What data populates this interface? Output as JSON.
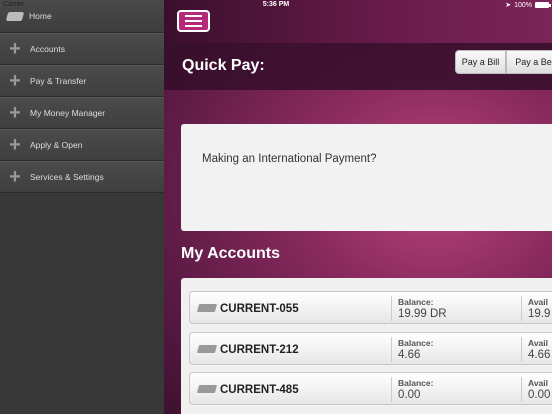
{
  "status_bar": {
    "carrier": "Carrier",
    "time": "5:36 PM",
    "battery": "100%"
  },
  "sidebar": {
    "home": "Home",
    "items": [
      {
        "label": "Accounts"
      },
      {
        "label": "Pay & Transfer"
      },
      {
        "label": "My Money Manager"
      },
      {
        "label": "Apply & Open"
      },
      {
        "label": "Services & Settings"
      }
    ]
  },
  "quick_pay": {
    "title": "Quick Pay:",
    "buttons": [
      "Pay a Bill",
      "Pay a Ben"
    ]
  },
  "intl_payment": {
    "text": "Making an International Payment?"
  },
  "accounts": {
    "title": "My Accounts",
    "balance_label": "Balance:",
    "available_label": "Avail",
    "rows": [
      {
        "name": "CURRENT-055",
        "balance": "19.99 DR",
        "available": "19.9"
      },
      {
        "name": "CURRENT-212",
        "balance": "4.66",
        "available": "4.66"
      },
      {
        "name": "CURRENT-485",
        "balance": "0.00",
        "available": "0.00"
      }
    ]
  }
}
